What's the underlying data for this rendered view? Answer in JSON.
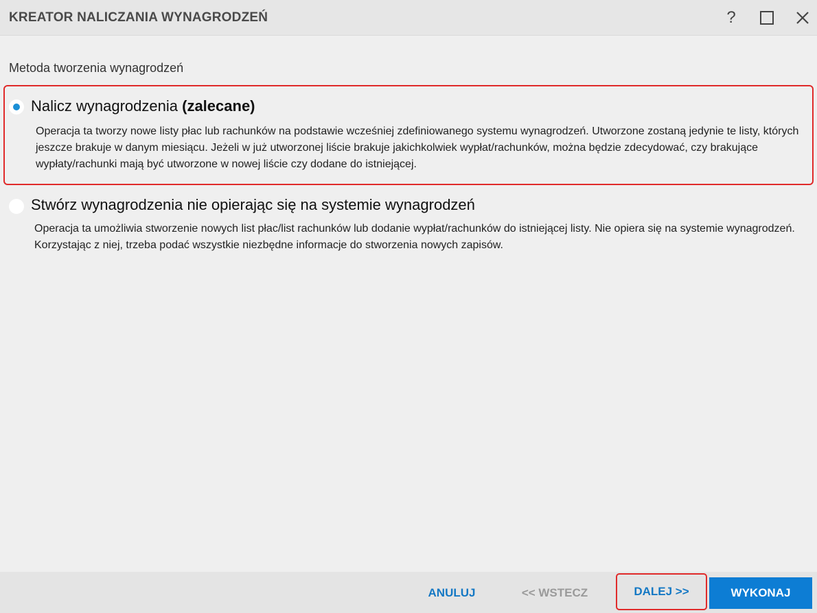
{
  "window": {
    "title": "KREATOR NALICZANIA WYNAGRODZEŃ",
    "help_label": "?"
  },
  "section": {
    "label": "Metoda tworzenia wynagrodzeń"
  },
  "options": [
    {
      "title": "Nalicz wynagrodzenia",
      "title_bold": "(zalecane)",
      "selected": true,
      "description": "Operacja ta tworzy nowe listy płac lub rachunków na podstawie wcześniej zdefiniowanego systemu wynagrodzeń. Utworzone zostaną jedynie te listy, których jeszcze brakuje w danym miesiącu. Jeżeli w już utworzonej liście brakuje jakichkolwiek wypłat/rachunków, można będzie zdecydować, czy brakujące wypłaty/rachunki mają być utworzone w nowej liście czy dodane do istniejącej."
    },
    {
      "title": "Stwórz wynagrodzenia nie opierając się na systemie wynagrodzeń",
      "selected": false,
      "description": "Operacja ta umożliwia stworzenie nowych list płac/list rachunków lub dodanie wypłat/rachunków do istniejącej listy. Nie opiera się na systemie wynagrodzeń. Korzystając z niej, trzeba podać wszystkie niezbędne informacje do stworzenia nowych zapisów."
    }
  ],
  "footer": {
    "cancel_label": "ANULUJ",
    "back_label": "<< WSTECZ",
    "next_label": "DALEJ >>",
    "execute_label": "WYKONAJ"
  },
  "colors": {
    "accent": "#0d7dd4",
    "link": "#1478c4",
    "highlight": "#e02a2a",
    "disabled": "#9a9a9a",
    "radio_selected": "#1b8fd6"
  },
  "icons": {
    "help": "help-icon",
    "maximize": "maximize-icon",
    "close": "close-icon"
  }
}
